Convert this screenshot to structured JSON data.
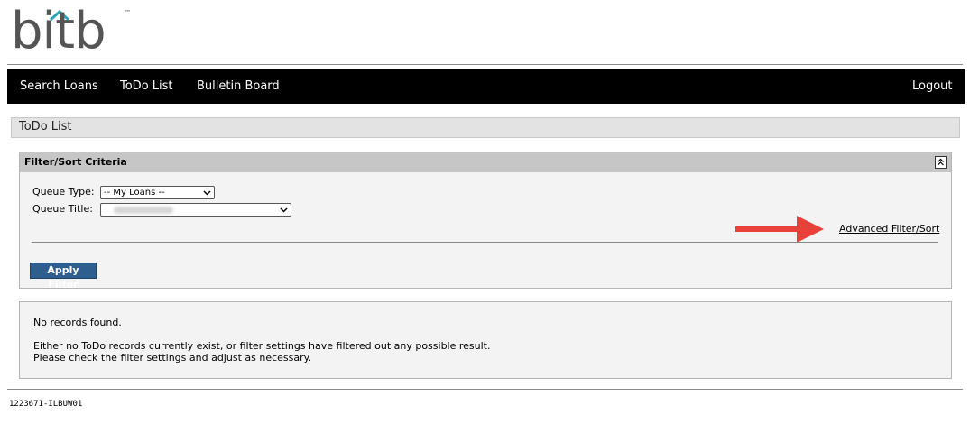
{
  "brand": {
    "logo_text": "bitb",
    "trademark": "™"
  },
  "nav": {
    "search_loans": "Search Loans",
    "todo_list": "ToDo List",
    "bulletin_board": "Bulletin Board",
    "logout": "Logout"
  },
  "page": {
    "title": "ToDo List"
  },
  "filter": {
    "header": "Filter/Sort Criteria",
    "queue_type_label": "Queue Type:",
    "queue_type_value": "-- My Loans --",
    "queue_title_label": "Queue Title:",
    "advanced_link": "Advanced Filter/Sort",
    "apply_button": "Apply Filter"
  },
  "results": {
    "no_records": "No records found.",
    "explanation_line1": "Either no ToDo records currently exist, or filter settings have filtered out any possible result.",
    "explanation_line2": "Please check the filter settings and adjust as necessary."
  },
  "footer": {
    "id": "1223671-ILBUW01"
  },
  "colors": {
    "navbar": "#000000",
    "apply_button": "#2e5e8e",
    "arrow": "#e8413a",
    "panel_header": "#c6c6c6"
  }
}
